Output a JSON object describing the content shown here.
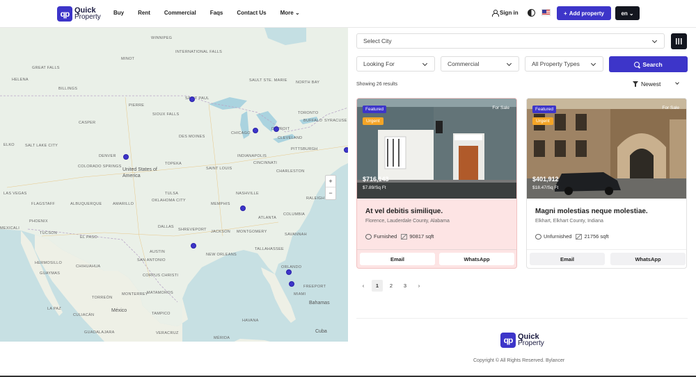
{
  "brand": {
    "badge": "qp",
    "line1": "Quick",
    "line2": "Property"
  },
  "nav": [
    "Buy",
    "Rent",
    "Commercial",
    "Faqs",
    "Contact Us",
    "More"
  ],
  "header": {
    "signin": "Sign in",
    "add_property": "Add property",
    "language": "en"
  },
  "colors": {
    "primary": "#3d35c9",
    "dark": "#13161f",
    "urgent": "#f4a426",
    "highlight_card": "#fde4e4"
  },
  "map": {
    "labels": {
      "winnipeg": "WINNIPEG",
      "intl_falls": "INTERNATIONAL FALLS",
      "minot": "MINOT",
      "great_falls": "GREAT FALLS",
      "helena": "HELENA",
      "billings": "BILLINGS",
      "pierre": "PIERRE",
      "st_paul": "SAINT PAUL",
      "sault": "SAULT STE. MARIE",
      "north_bay": "NORTH BAY",
      "sioux_falls": "SIOUX FALLS",
      "toronto": "TORONTO",
      "casper": "CASPER",
      "buffalo": "BUFFALO",
      "syracuse": "SYRACUSE",
      "chicago": "CHICAGO",
      "detroit": "DETROIT",
      "des_moines": "DES MOINES",
      "cleveland": "CLEVELAND",
      "elko": "ELKO",
      "salt_lake": "SALT LAKE CITY",
      "denver": "DENVER",
      "pittsburgh": "PITTSBURGH",
      "indianapolis": "INDIANAPOLIS",
      "topeka": "TOPEKA",
      "colorado_springs": "COLORADO SPRINGS",
      "usa": "United States of America",
      "cincinnati": "CINCINNATI",
      "saint_louis": "SAINT LOUIS",
      "charleston": "CHARLESTON",
      "las_vegas": "LAS VEGAS",
      "tulsa": "TULSA",
      "nashville": "NASHVILLE",
      "flagstaff": "FLAGSTAFF",
      "albuquerque": "ALBUQUERQUE",
      "amarillo": "AMARILLO",
      "okc": "OKLAHOMA CITY",
      "memphis": "MEMPHIS",
      "raleigh": "RALEIGH",
      "phoenix": "PHOENIX",
      "atlanta": "ATLANTA",
      "columbia": "COLUMBIA",
      "dallas": "DALLAS",
      "shreveport": "SHREVEPORT",
      "jackson": "JACKSON",
      "montgomery": "MONTGOMERY",
      "mexicali": "MEXICALI",
      "tucson": "TUCSON",
      "el_paso": "EL PASO",
      "savannah": "SAVANNAH",
      "tallahassee": "TALLAHASSEE",
      "austin": "AUSTIN",
      "new_orleans": "NEW ORLEANS",
      "hermosillo": "HERMOSILLO",
      "chihuahua": "CHIHUAHUA",
      "san_antonio": "SAN ANTONIO",
      "orlando": "ORLANDO",
      "guaymas": "GUAYMAS",
      "corpus_christi": "CORPUS CHRISTI",
      "freeport": "FREEPORT",
      "matamoros": "MATAMOROS",
      "miami": "MIAMI",
      "monterrey": "MONTERREY",
      "torreon": "TORREÓN",
      "bahamas": "Bahamas",
      "la_paz": "LA PAZ",
      "mexico": "México",
      "tampico": "TAMPICO",
      "havana": "HAVANA",
      "culiacan": "CULIACÁN",
      "cuba": "Cuba",
      "guadalajara": "GUADALAJARA",
      "veracruz": "VERACRUZ",
      "merida": "MÉRIDA"
    },
    "pins": [
      "Saint Paul",
      "Chicago",
      "Detroit",
      "Boston",
      "Denver",
      "Memphis",
      "Shreveport",
      "Orlando",
      "Miami"
    ],
    "zoom_in": "+",
    "zoom_out": "−"
  },
  "search": {
    "city": "Select City",
    "looking_for": "Looking For",
    "category": "Commercial",
    "property_type": "All Property Types",
    "button": "Search"
  },
  "results_text": "Showing 26 results",
  "sort": "Newest",
  "listings": [
    {
      "featured": "Featured",
      "urgent": "Urgent",
      "status": "For Sale",
      "price": "$716,143",
      "price_per_sqft": "$7.89/Sq Ft",
      "title": "At vel debitis similique.",
      "location": "Florence, Lauderdale County, Alabama",
      "furnishing": "Furnished",
      "area": "90817 sqft",
      "email": "Email",
      "whatsapp": "WhatsApp",
      "highlighted": true
    },
    {
      "featured": "Featured",
      "urgent": "Urgent",
      "status": "For Sale",
      "price": "$401,912",
      "price_per_sqft": "$18.47/Sq Ft",
      "title": "Magni molestias neque molestiae.",
      "location": "Elkhart, Elkhart County, Indiana",
      "furnishing": "Unfurnished",
      "area": "21756 sqft",
      "email": "Email",
      "whatsapp": "WhatsApp",
      "highlighted": false
    }
  ],
  "pagination": {
    "prev": "‹",
    "pages": [
      "1",
      "2",
      "3"
    ],
    "current": 1,
    "next": "›"
  },
  "footer": {
    "copyright": "Copyright © All Rights Reserved. Bylancer"
  }
}
